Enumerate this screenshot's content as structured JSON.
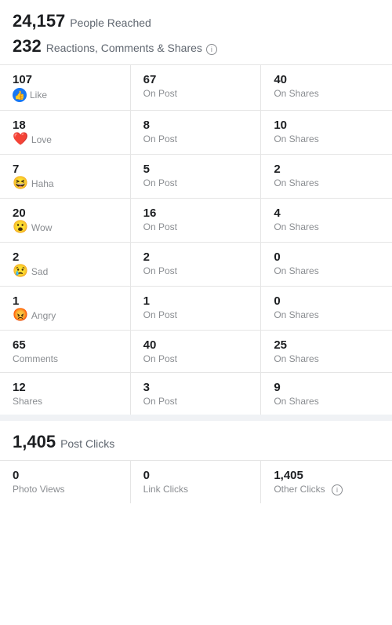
{
  "summary": {
    "people_reached_number": "24,157",
    "people_reached_label": "People Reached",
    "reactions_number": "232",
    "reactions_label": "Reactions, Comments & Shares"
  },
  "stat_rows": [
    {
      "col1_number": "107",
      "col1_label": "Like",
      "col1_type": "like",
      "col2_number": "67",
      "col2_label": "On Post",
      "col3_number": "40",
      "col3_label": "On Shares"
    },
    {
      "col1_number": "18",
      "col1_label": "Love",
      "col1_type": "love",
      "col2_number": "8",
      "col2_label": "On Post",
      "col3_number": "10",
      "col3_label": "On Shares"
    },
    {
      "col1_number": "7",
      "col1_label": "Haha",
      "col1_type": "haha",
      "col2_number": "5",
      "col2_label": "On Post",
      "col3_number": "2",
      "col3_label": "On Shares"
    },
    {
      "col1_number": "20",
      "col1_label": "Wow",
      "col1_type": "wow",
      "col2_number": "16",
      "col2_label": "On Post",
      "col3_number": "4",
      "col3_label": "On Shares"
    },
    {
      "col1_number": "2",
      "col1_label": "Sad",
      "col1_type": "sad",
      "col2_number": "2",
      "col2_label": "On Post",
      "col3_number": "0",
      "col3_label": "On Shares"
    },
    {
      "col1_number": "1",
      "col1_label": "Angry",
      "col1_type": "angry",
      "col2_number": "1",
      "col2_label": "On Post",
      "col3_number": "0",
      "col3_label": "On Shares"
    },
    {
      "col1_number": "65",
      "col1_label": "Comments",
      "col1_type": "text",
      "col2_number": "40",
      "col2_label": "On Post",
      "col3_number": "25",
      "col3_label": "On Shares"
    },
    {
      "col1_number": "12",
      "col1_label": "Shares",
      "col1_type": "text",
      "col2_number": "3",
      "col2_label": "On Post",
      "col3_number": "9",
      "col3_label": "On Shares"
    }
  ],
  "post_clicks": {
    "label": "Post Clicks",
    "number": "1,405"
  },
  "click_rows": [
    {
      "col1_number": "0",
      "col1_label": "Photo Views",
      "col2_number": "0",
      "col2_label": "Link Clicks",
      "col3_number": "1,405",
      "col3_label": "Other Clicks"
    }
  ],
  "emojis": {
    "like": "👍",
    "love": "❤️",
    "haha": "😆",
    "wow": "😮",
    "sad": "😢",
    "angry": "😡"
  }
}
